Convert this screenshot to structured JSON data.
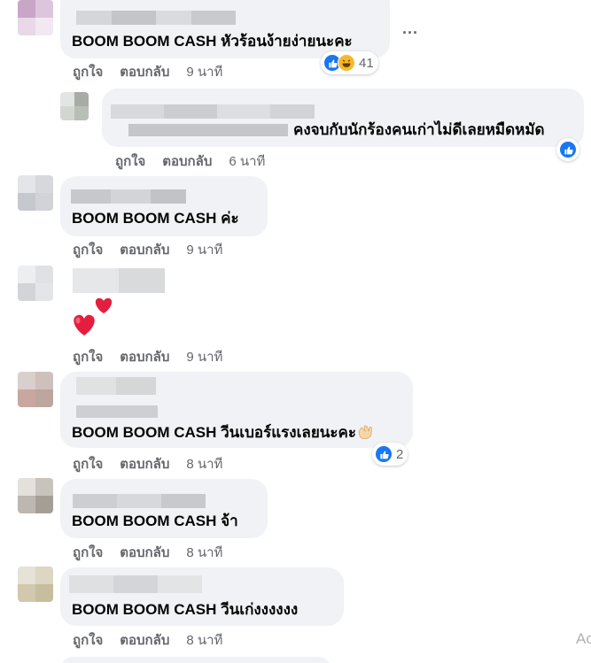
{
  "comments": [
    {
      "text": "BOOM BOOM CASH หัวร้อนง้ายง่ายนะคะ",
      "like": "ถูกใจ",
      "reply": "ตอบกลับ",
      "time": "9 นาที",
      "reaction_count": "41",
      "reactions": [
        "like-icon",
        "haha-icon"
      ]
    },
    {
      "text": "คงจบกับนักร้องคนเก่าไม่ดีเลยหมืดหมัด",
      "like": "ถูกใจ",
      "reply": "ตอบกลับ",
      "time": "6 นาที",
      "reactions": [
        "like-icon"
      ]
    },
    {
      "text": "BOOM BOOM CASH ค่ะ",
      "like": "ถูกใจ",
      "reply": "ตอบกลับ",
      "time": "9 นาที"
    },
    {
      "text": "",
      "like": "ถูกใจ",
      "reply": "ตอบกลับ",
      "time": "9 นาที",
      "sticker": "two-hearts-icon"
    },
    {
      "text": "BOOM BOOM CASH วีนเบอร์แรงเลยนะคะ",
      "like": "ถูกใจ",
      "reply": "ตอบกลับ",
      "time": "8 นาที",
      "reaction_count": "2",
      "reactions": [
        "like-icon"
      ]
    },
    {
      "text": "BOOM BOOM CASH จ้า",
      "like": "ถูกใจ",
      "reply": "ตอบกลับ",
      "time": "8 นาที"
    },
    {
      "text": "BOOM BOOM CASH วีนเก่งงงงงง",
      "like": "ถูกใจ",
      "reply": "ตอบกลับ",
      "time": "8 นาที"
    }
  ],
  "more_options": "...",
  "watermark": "Ac",
  "colors": {
    "bubble": "#f0f2f5",
    "action_text": "#65676b",
    "like_blue": "#1877f2",
    "haha_yellow": "#f7b928",
    "heart_red": "#e41e3f"
  }
}
